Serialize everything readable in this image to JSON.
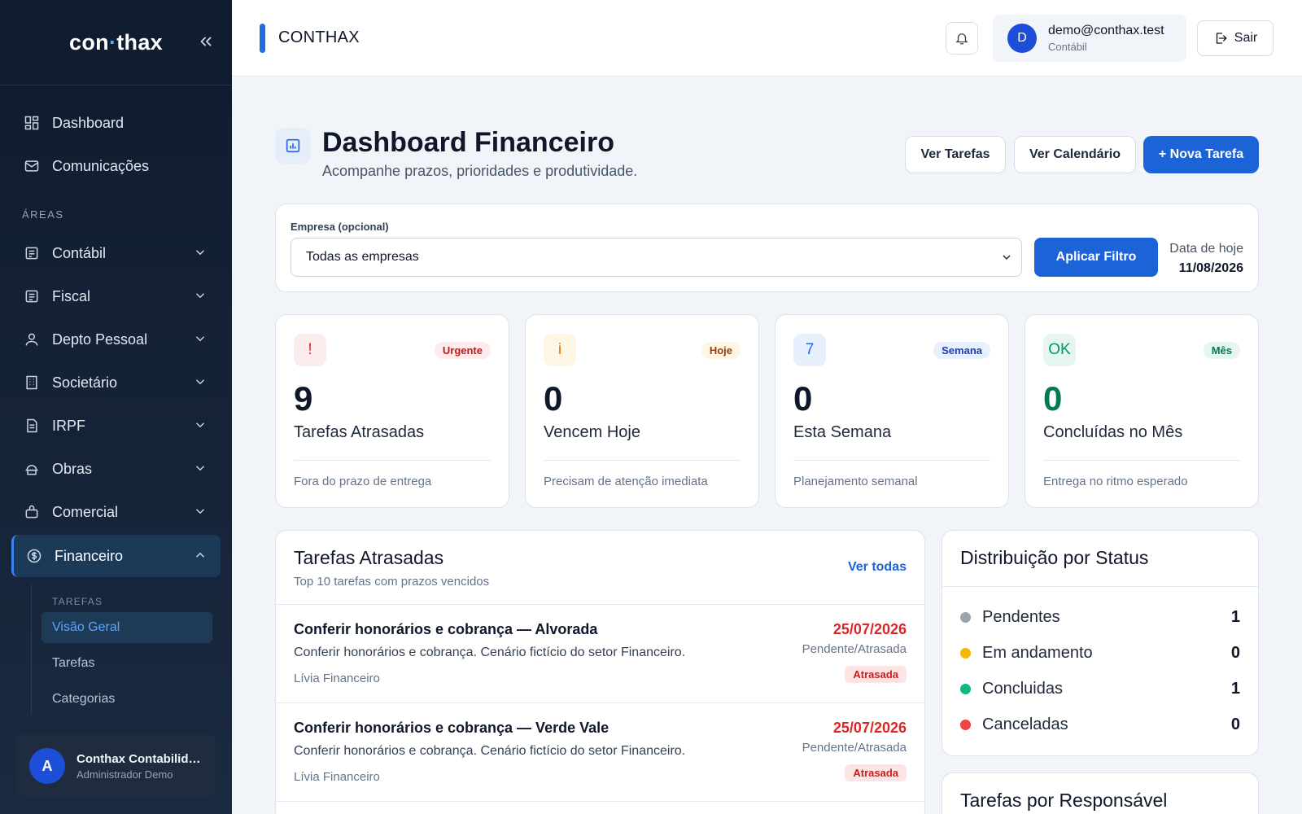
{
  "sidebar": {
    "logo_left": "con",
    "logo_dot": "·",
    "logo_right": "thax",
    "collapse_icon": "double-chevron-left-icon",
    "top_items": [
      {
        "label": "Dashboard",
        "icon": "dashboard-icon"
      },
      {
        "label": "Comunicações",
        "icon": "mail-icon"
      }
    ],
    "section_label": "ÁREAS",
    "areas": [
      {
        "label": "Contábil",
        "icon": "ledger-icon"
      },
      {
        "label": "Fiscal",
        "icon": "receipt-icon"
      },
      {
        "label": "Depto Pessoal",
        "icon": "user-icon"
      },
      {
        "label": "Societário",
        "icon": "building-icon"
      },
      {
        "label": "IRPF",
        "icon": "document-icon"
      },
      {
        "label": "Obras",
        "icon": "construction-icon"
      },
      {
        "label": "Comercial",
        "icon": "briefcase-icon"
      },
      {
        "label": "Financeiro",
        "icon": "dollar-circle-icon",
        "active": true
      }
    ],
    "sub": {
      "label": "TAREFAS",
      "items": [
        "Visão Geral",
        "Tarefas",
        "Categorias"
      ],
      "selected": "Visão Geral"
    },
    "user": {
      "initial": "A",
      "name": "Conthax Contabilidade",
      "role": "Administrador Demo"
    }
  },
  "topbar": {
    "title": "CONTHAX",
    "user_initial": "D",
    "user_email": "demo@conthax.test",
    "user_role": "Contábil",
    "logout_label": "Sair"
  },
  "header": {
    "title": "Dashboard Financeiro",
    "subtitle": "Acompanhe prazos, prioridades e produtividade.",
    "btn_tasks": "Ver Tarefas",
    "btn_calendar": "Ver Calendário",
    "btn_new": "+ Nova Tarefa"
  },
  "filter": {
    "label": "Empresa (opcional)",
    "selected": "Todas as empresas",
    "apply_label": "Aplicar Filtro",
    "today_label": "Data de hoje",
    "today_value": "11/08/2026"
  },
  "stats": [
    {
      "icon_text": "!",
      "badge": "Urgente",
      "value": "9",
      "label": "Tarefas Atrasadas",
      "foot": "Fora do prazo de entrega",
      "color": "#dc2626",
      "icon_bg": "#fdecec",
      "badge_bg": "#fdecec",
      "badge_color": "#b91c1c",
      "num_color": "#0f172a"
    },
    {
      "icon_text": "i",
      "badge": "Hoje",
      "value": "0",
      "label": "Vencem Hoje",
      "foot": "Precisam de atenção imediata",
      "color": "#d97706",
      "icon_bg": "#fef6e4",
      "badge_bg": "#fef6e4",
      "badge_color": "#92400e",
      "num_color": "#0f172a"
    },
    {
      "icon_text": "7",
      "badge": "Semana",
      "value": "0",
      "label": "Esta Semana",
      "foot": "Planejamento semanal",
      "color": "#2563eb",
      "icon_bg": "#e8f0fd",
      "badge_bg": "#e8f0fd",
      "badge_color": "#1e40af",
      "num_color": "#0f172a"
    },
    {
      "icon_text": "OK",
      "badge": "Mês",
      "value": "0",
      "label": "Concluídas no Mês",
      "foot": "Entrega no ritmo esperado",
      "color": "#059669",
      "icon_bg": "#e6f6ee",
      "badge_bg": "#e6f6ee",
      "badge_color": "#047857",
      "num_color": "#047857"
    }
  ],
  "late": {
    "title": "Tarefas Atrasadas",
    "subtitle": "Top 10 tarefas com prazos vencidos",
    "see_all": "Ver todas",
    "rows": [
      {
        "title": "Conferir honorários e cobrança — Alvorada",
        "desc": "Conferir honorários e cobrança. Cenário fictício do setor Financeiro.",
        "assignee": "Lívia Financeiro",
        "date": "25/07/2026",
        "status": "Pendente/Atrasada",
        "badge": "Atrasada"
      },
      {
        "title": "Conferir honorários e cobrança — Verde Vale",
        "desc": "Conferir honorários e cobrança. Cenário fictício do setor Financeiro.",
        "assignee": "Lívia Financeiro",
        "date": "25/07/2026",
        "status": "Pendente/Atrasada",
        "badge": "Atrasada"
      }
    ]
  },
  "distribution": {
    "title": "Distribuição por Status",
    "rows": [
      {
        "label": "Pendentes",
        "value": "1",
        "color": "#9ca3af"
      },
      {
        "label": "Em andamento",
        "value": "0",
        "color": "#f5b50a"
      },
      {
        "label": "Concluidas",
        "value": "1",
        "color": "#10b981"
      },
      {
        "label": "Canceladas",
        "value": "0",
        "color": "#ef4444"
      }
    ]
  },
  "responsible": {
    "title": "Tarefas por Responsável"
  }
}
